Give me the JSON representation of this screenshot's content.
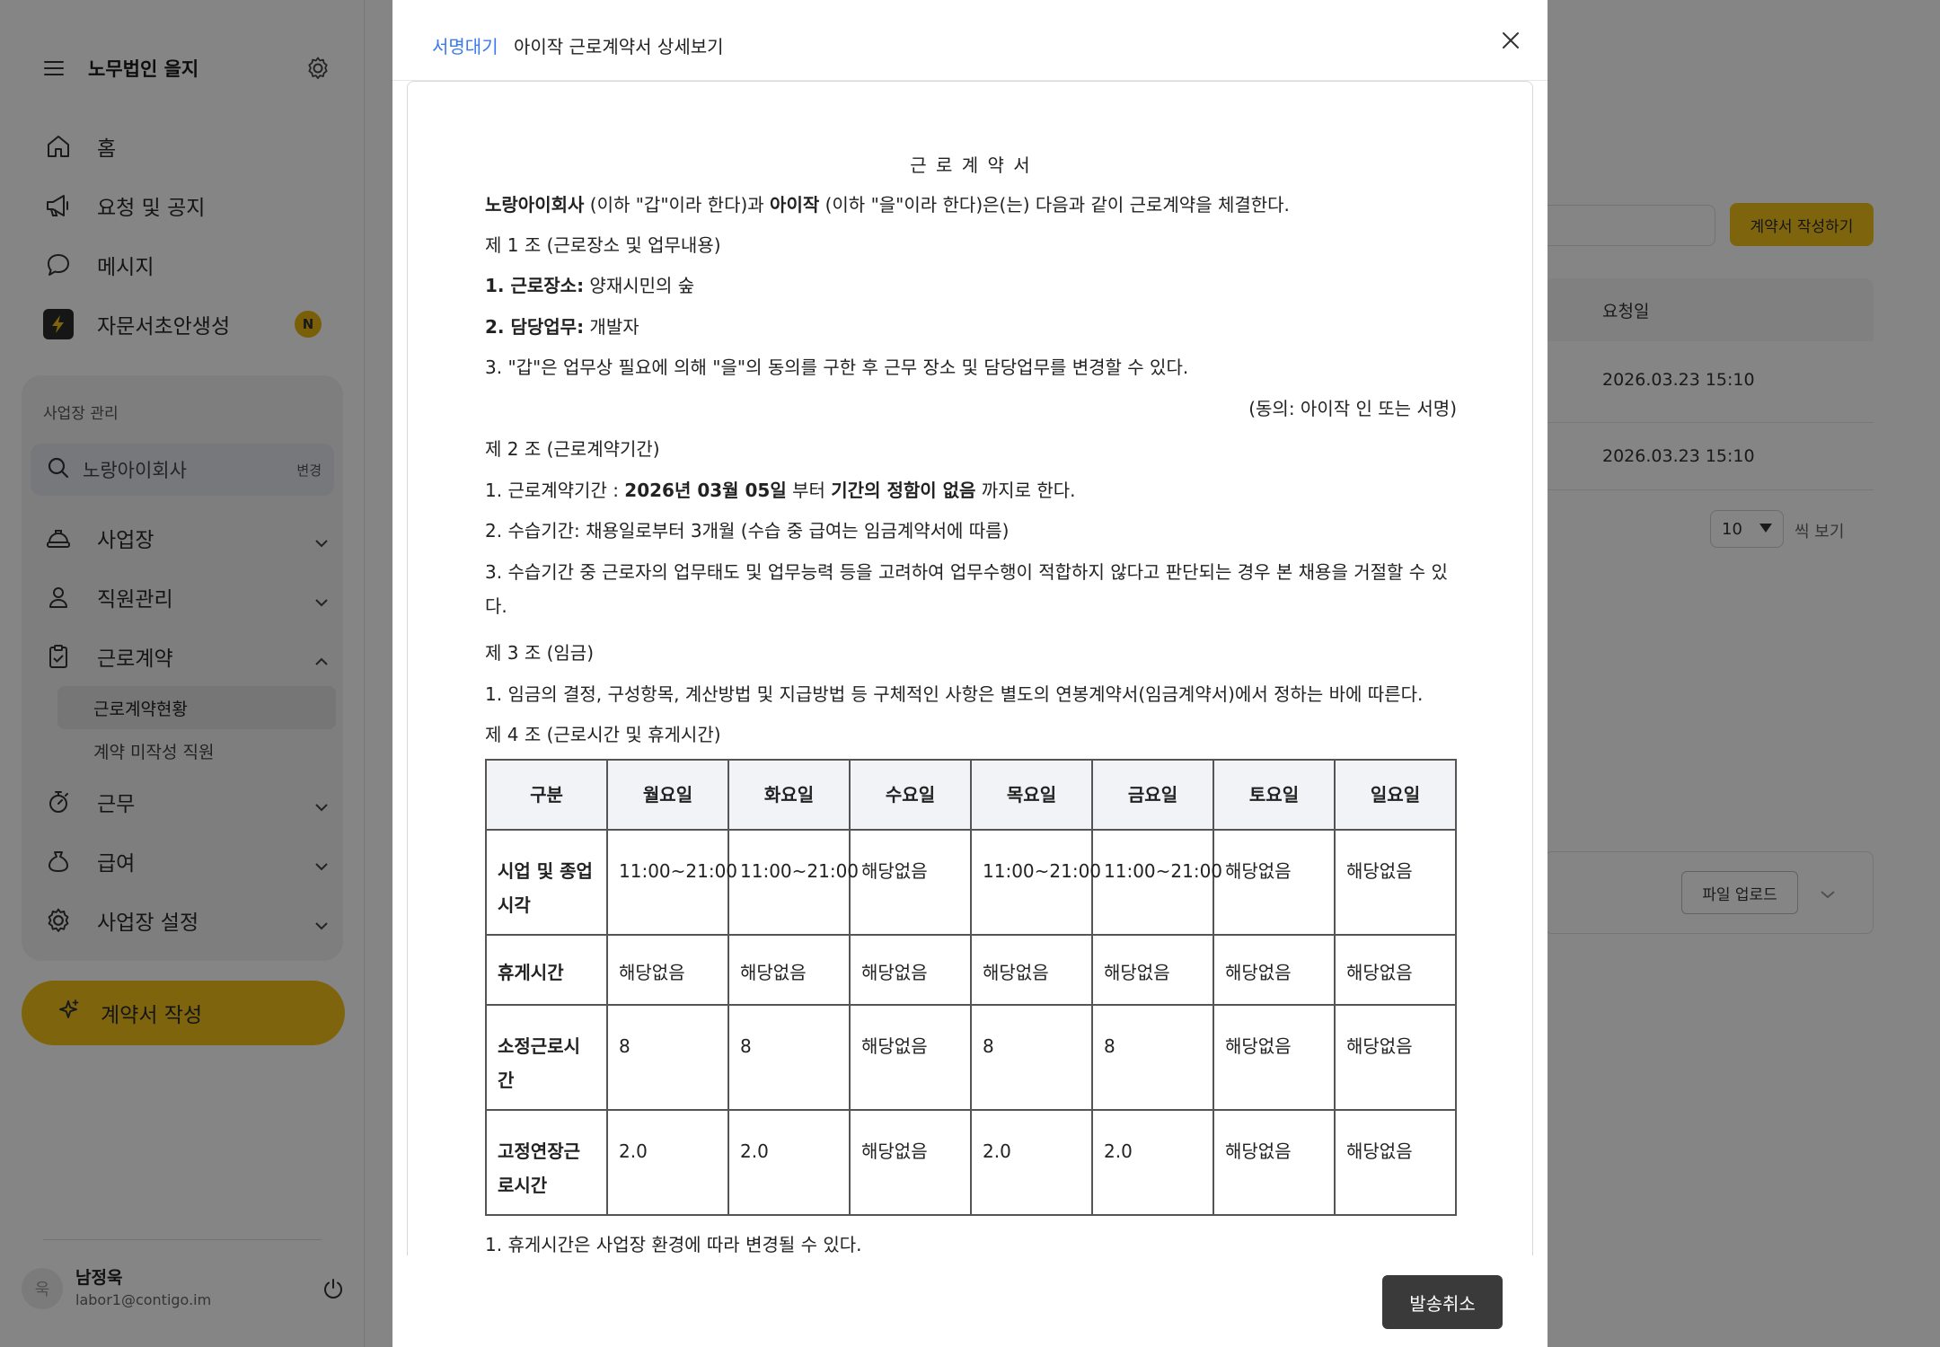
{
  "sidebar": {
    "org_name": "노무법인 을지",
    "nav": [
      "홈",
      "요청 및 공지",
      "메시지",
      "자문서초안생성"
    ],
    "nav_badge": "N",
    "management": {
      "title": "사업장 관리",
      "search_value": "노랑아이회사",
      "change_label": "변경",
      "items": [
        "사업장",
        "직원관리",
        "근로계약",
        "근무",
        "급여",
        "사업장 설정"
      ],
      "sub_items": [
        "근로계약현황",
        "계약 미작성 직원"
      ]
    },
    "cta_label": "계약서 작성",
    "user": {
      "avatar_char": "욱",
      "name": "남정욱",
      "email": "labor1@contigo.im"
    }
  },
  "background": {
    "write_button": "계약서 작성하기",
    "col_request_date": "요청일",
    "rows": [
      "2026.03.23 15:10",
      "2026.03.23 15:10"
    ],
    "page_size": "10",
    "per_view": "씩 보기",
    "upload_button": "파일 업로드"
  },
  "modal": {
    "status": "서명대기",
    "title": "아이작 근로계약서 상세보기",
    "cancel_button": "발송취소",
    "doc": {
      "title": "근 로 계 약 서",
      "intro": {
        "employer": "노랑아이회사",
        "t1": " (이하 \"갑\"이라 한다)과 ",
        "employee": "아이작",
        "t2": " (이하 \"을\"이라 한다)은(는) 다음과 같이 근로계약을 체결한다."
      },
      "art1": "제 1 조 (근로장소 및 업무내용)",
      "art1_l1_label": "1. 근로장소:",
      "art1_l1_value": " 양재시민의 숲",
      "art1_l2_label": "2. 담당업무:",
      "art1_l2_value": " 개발자",
      "art1_l3": "3. \"갑\"은 업무상 필요에 의해 \"을\"의 동의를 구한 후 근무 장소 및 담당업무를 변경할 수 있다.",
      "consent": "(동의: 아이작 인 또는 서명)",
      "art2": "제 2 조 (근로계약기간)",
      "art2_l1_a": "1. 근로계약기간 : ",
      "art2_l1_start": "2026년 03월 05일",
      "art2_l1_b": " 부터 ",
      "art2_l1_end": "기간의 정함이 없음",
      "art2_l1_c": " 까지로 한다.",
      "art2_l2": "2. 수습기간: 채용일로부터 3개월 (수습 중 급여는 임금계약서에 따름)",
      "art2_l3": "3. 수습기간 중 근로자의 업무태도 및 업무능력 등을 고려하여 업무수행이 적합하지 않다고 판단되는 경우 본 채용을 거절할 수 있다.",
      "art3": "제 3 조 (임금)",
      "art3_l1": "1. 임금의 결정, 구성항목, 계산방법 및 지급방법 등 구체적인 사항은 별도의 연봉계약서(임금계약서)에서 정하는 바에 따른다.",
      "art4": "제 4 조 (근로시간 및 휴게시간)",
      "table": {
        "headers": [
          "구분",
          "월요일",
          "화요일",
          "수요일",
          "목요일",
          "금요일",
          "토요일",
          "일요일"
        ],
        "rows": [
          [
            "시업 및 종업시각",
            "11:00~21:00",
            "11:00~21:00",
            "해당없음",
            "11:00~21:00",
            "11:00~21:00",
            "해당없음",
            "해당없음"
          ],
          [
            "휴게시간",
            "해당없음",
            "해당없음",
            "해당없음",
            "해당없음",
            "해당없음",
            "해당없음",
            "해당없음"
          ],
          [
            "소정근로시간",
            "8",
            "8",
            "해당없음",
            "8",
            "8",
            "해당없음",
            "해당없음"
          ],
          [
            "고정연장근로시간",
            "2.0",
            "2.0",
            "해당없음",
            "2.0",
            "2.0",
            "해당없음",
            "해당없음"
          ]
        ]
      },
      "note1": "1. 휴게시간은 사업장 환경에 따라 변경될 수 있다."
    }
  }
}
